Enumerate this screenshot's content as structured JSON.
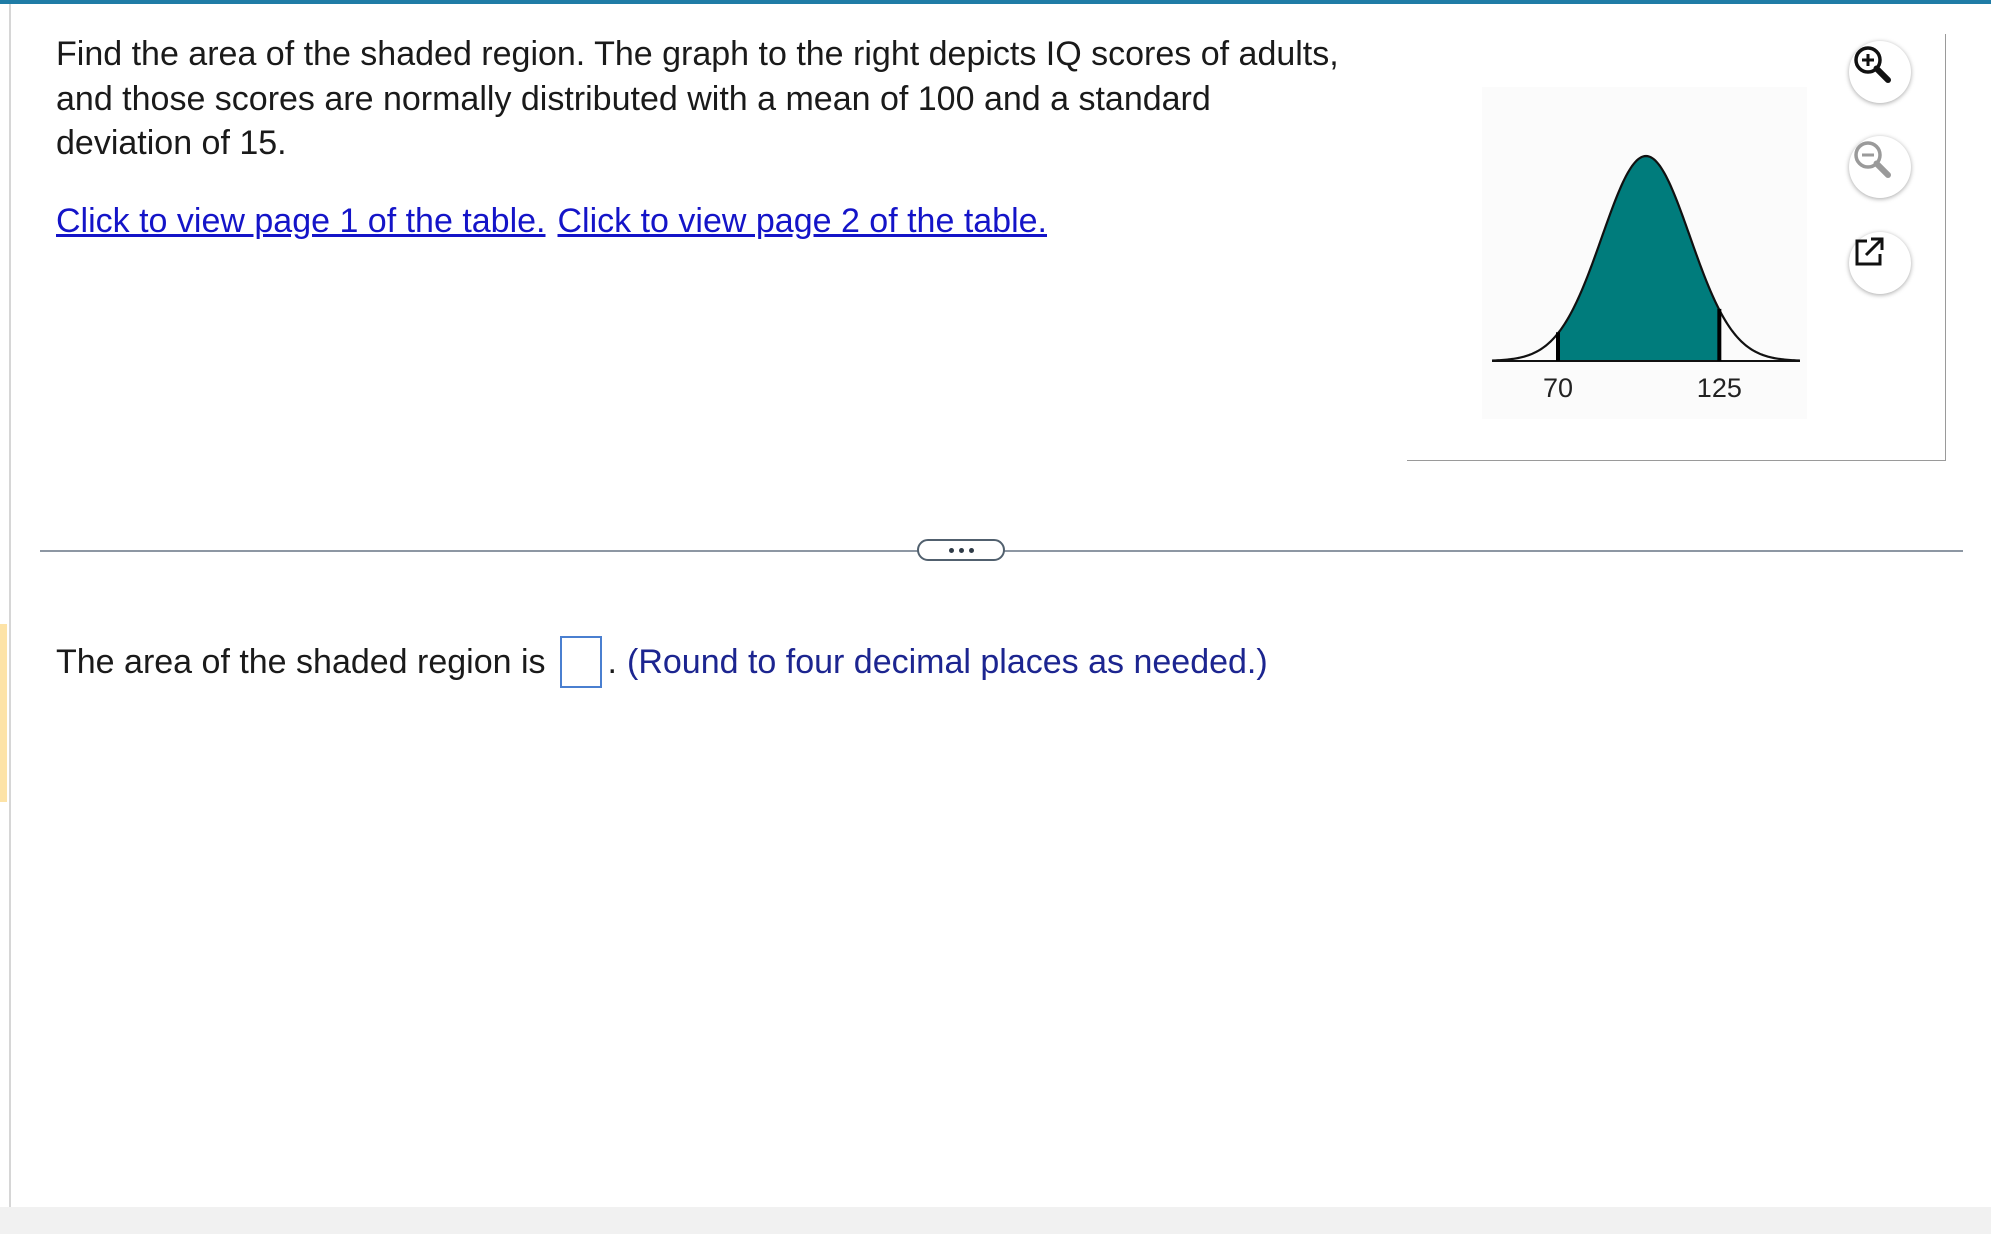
{
  "question": {
    "text": "Find the area of the shaded region. The graph to the right depicts IQ scores of adults, and those scores are normally distributed with a mean of 100 and a standard deviation of 15."
  },
  "links": {
    "page1": "Click to view page 1 of the table.",
    "page2": "Click to view page 2 of the table."
  },
  "graph": {
    "mean": 100,
    "sd": 15,
    "shade_from": 70,
    "shade_to": 125,
    "label_left": "70",
    "label_right": "125",
    "shade_color": "#007c7c"
  },
  "toolbar": {
    "zoom_in_icon": "zoom-in-icon",
    "zoom_out_icon": "zoom-out-icon",
    "popout_icon": "external-link-icon"
  },
  "answer": {
    "prefix": "The area of the shaded region is",
    "value": "",
    "suffix": ".",
    "hint": "(Round to four decimal places as needed.)"
  }
}
